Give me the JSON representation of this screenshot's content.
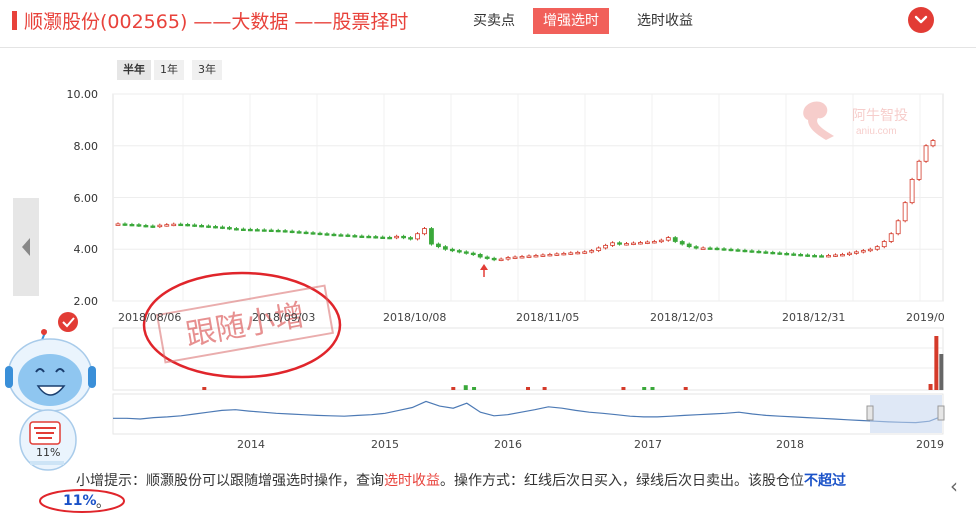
{
  "header": {
    "title": "顺灏股份(002565) ——大数据 ——股票择时",
    "tabs": [
      {
        "label": "买卖点",
        "active": false
      },
      {
        "label": "增强选时",
        "active": true
      },
      {
        "label": "选时收益",
        "active": false
      }
    ]
  },
  "range_buttons": [
    "半年",
    "1年",
    "3年"
  ],
  "watermark": {
    "brand_cn": "阿牛智投",
    "brand_en": "aniu.com"
  },
  "stamp_text": "跟随小增",
  "mascot": {
    "position_label": "11%"
  },
  "tip": {
    "prefix": "小增提示：顺灏股份可以跟随增强选时操作，查询",
    "link": "选时收益",
    "middle": "。操作方式：红线后次日买入，绿线后次日卖出。该股仓位",
    "highlight_a": "不超过",
    "highlight_b": "11%",
    "tail": "。"
  },
  "colors": {
    "brand_red": "#e8423b",
    "up": "#d43a2a",
    "down": "#3aa83a",
    "navigator_line": "#4d7ab5"
  },
  "chart_data": {
    "type": "candlestick",
    "y_ticks": [
      "10.00",
      "8.00",
      "6.00",
      "4.00",
      "2.00"
    ],
    "ylim": [
      2,
      10
    ],
    "x_ticks": [
      "2018/08/06",
      "2018/09/03",
      "2018/10/08",
      "2018/11/05",
      "2018/12/03",
      "2018/12/31",
      "2019/0"
    ],
    "grid": true,
    "close_series": [
      4.98,
      4.96,
      4.95,
      4.92,
      4.9,
      4.88,
      4.93,
      4.95,
      4.97,
      4.96,
      4.94,
      4.92,
      4.9,
      4.88,
      4.86,
      4.84,
      4.8,
      4.78,
      4.77,
      4.76,
      4.75,
      4.74,
      4.73,
      4.72,
      4.7,
      4.68,
      4.66,
      4.64,
      4.62,
      4.6,
      4.58,
      4.56,
      4.55,
      4.53,
      4.51,
      4.5,
      4.49,
      4.47,
      4.46,
      4.45,
      4.5,
      4.45,
      4.4,
      4.6,
      4.8,
      4.2,
      4.1,
      4.0,
      3.95,
      3.9,
      3.85,
      3.8,
      3.7,
      3.65,
      3.6,
      3.62,
      3.68,
      3.7,
      3.72,
      3.74,
      3.76,
      3.78,
      3.8,
      3.82,
      3.84,
      3.86,
      3.88,
      3.9,
      3.95,
      4.05,
      4.15,
      4.25,
      4.2,
      4.22,
      4.24,
      4.26,
      4.28,
      4.3,
      4.35,
      4.45,
      4.3,
      4.2,
      4.1,
      4.05,
      4.05,
      4.04,
      4.02,
      4.0,
      3.98,
      3.96,
      3.94,
      3.92,
      3.9,
      3.88,
      3.86,
      3.84,
      3.82,
      3.8,
      3.78,
      3.76,
      3.75,
      3.74,
      3.76,
      3.78,
      3.8,
      3.85,
      3.9,
      3.95,
      4.0,
      4.1,
      4.3,
      4.6,
      5.1,
      5.8,
      6.7,
      7.4,
      8.0,
      8.2
    ],
    "volume_bars": [
      {
        "x_frac": 0.11,
        "v": 0.05,
        "c": "up"
      },
      {
        "x_frac": 0.41,
        "v": 0.05,
        "c": "up"
      },
      {
        "x_frac": 0.425,
        "v": 0.08,
        "c": "down"
      },
      {
        "x_frac": 0.435,
        "v": 0.05,
        "c": "down"
      },
      {
        "x_frac": 0.5,
        "v": 0.05,
        "c": "up"
      },
      {
        "x_frac": 0.52,
        "v": 0.05,
        "c": "up"
      },
      {
        "x_frac": 0.615,
        "v": 0.05,
        "c": "up"
      },
      {
        "x_frac": 0.64,
        "v": 0.05,
        "c": "down"
      },
      {
        "x_frac": 0.65,
        "v": 0.05,
        "c": "down"
      },
      {
        "x_frac": 0.69,
        "v": 0.05,
        "c": "up"
      },
      {
        "x_frac": 0.985,
        "v": 0.1,
        "c": "up"
      },
      {
        "x_frac": 0.992,
        "v": 0.9,
        "c": "up"
      },
      {
        "x_frac": 0.998,
        "v": 0.6,
        "c": "gray"
      }
    ],
    "navigator": {
      "x_ticks": [
        "2014",
        "2015",
        "2016",
        "2017",
        "2018",
        "2019"
      ],
      "series": [
        0.38,
        0.38,
        0.36,
        0.4,
        0.42,
        0.45,
        0.5,
        0.55,
        0.6,
        0.62,
        0.58,
        0.55,
        0.52,
        0.5,
        0.48,
        0.46,
        0.45,
        0.44,
        0.46,
        0.48,
        0.52,
        0.6,
        0.68,
        0.85,
        0.72,
        0.66,
        0.8,
        0.55,
        0.45,
        0.48,
        0.55,
        0.62,
        0.7,
        0.66,
        0.6,
        0.55,
        0.52,
        0.48,
        0.44,
        0.42,
        0.42,
        0.44,
        0.46,
        0.48,
        0.5,
        0.52,
        0.55,
        0.5,
        0.46,
        0.44,
        0.42,
        0.4,
        0.38,
        0.36,
        0.34,
        0.32,
        0.3,
        0.28,
        0.27,
        0.26,
        0.3,
        0.45
      ]
    }
  }
}
